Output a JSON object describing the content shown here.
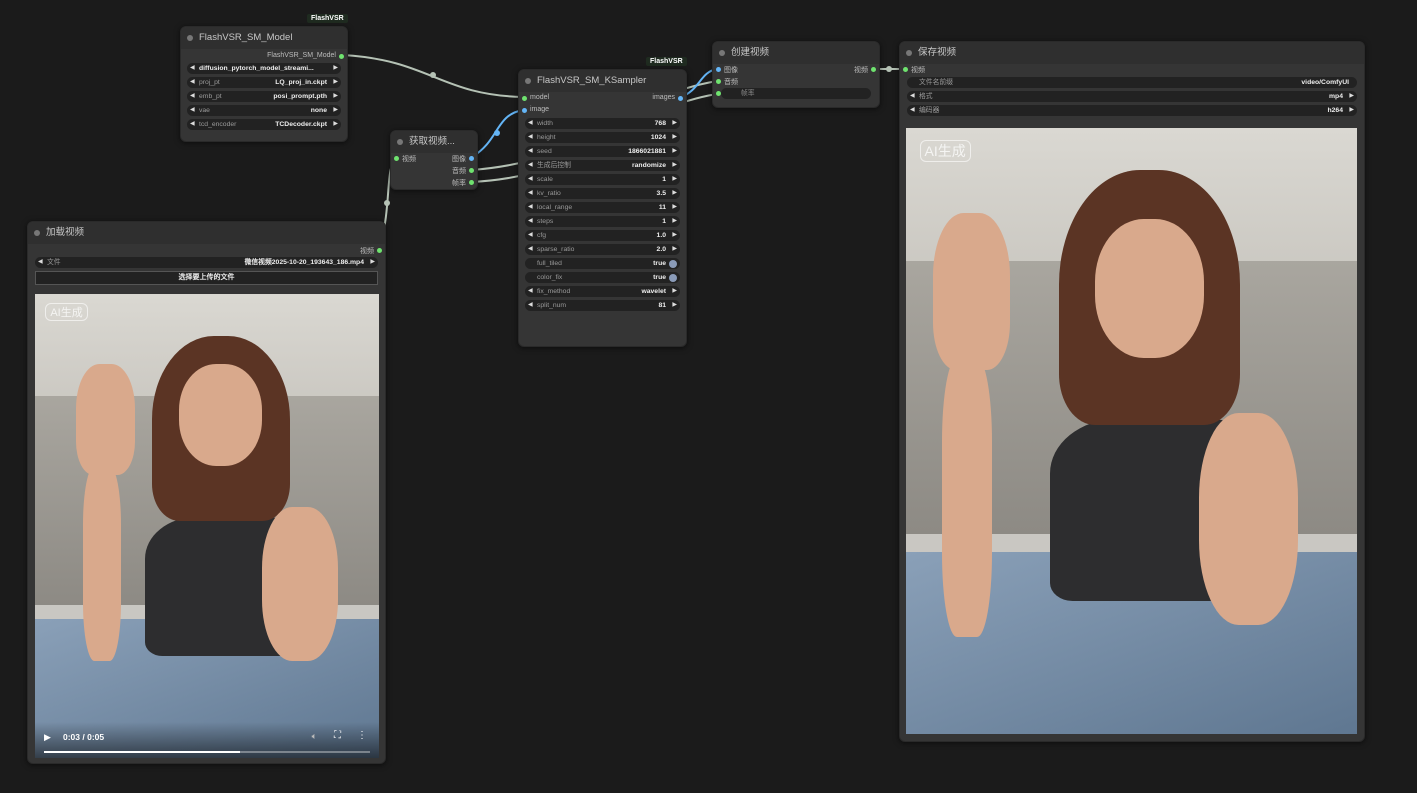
{
  "colors": {
    "canvas": "#1b1b1b",
    "node": "#353535",
    "slot_image": "#64b5f6",
    "slot_other": "#6fe36f"
  },
  "model_node": {
    "title": "FlashVSR_SM_Model",
    "badge": "FlashVSR",
    "output": "FlashVSR_SM_Model",
    "widgets": [
      {
        "label": "",
        "value": "diffusion_pytorch_model_streami..."
      },
      {
        "label": "proj_pt",
        "value": "LQ_proj_in.ckpt"
      },
      {
        "label": "emb_pt",
        "value": "posi_prompt.pth"
      },
      {
        "label": "vae",
        "value": "none"
      },
      {
        "label": "tcd_encoder",
        "value": "TCDecoder.ckpt"
      }
    ]
  },
  "get_video_node": {
    "title": "获取视频...",
    "input": "视频",
    "outputs": [
      "图像",
      "音频",
      "帧率"
    ]
  },
  "sampler_node": {
    "title": "FlashVSR_SM_KSampler",
    "badge": "FlashVSR",
    "inputs": [
      "model",
      "image"
    ],
    "output": "images",
    "widgets": [
      {
        "label": "width",
        "value": "768"
      },
      {
        "label": "height",
        "value": "1024"
      },
      {
        "label": "seed",
        "value": "1866021881"
      },
      {
        "label": "生成后控制",
        "value": "randomize"
      },
      {
        "label": "scale",
        "value": "1"
      },
      {
        "label": "kv_ratio",
        "value": "3.5"
      },
      {
        "label": "local_range",
        "value": "11"
      },
      {
        "label": "steps",
        "value": "1"
      },
      {
        "label": "cfg",
        "value": "1.0"
      },
      {
        "label": "sparse_ratio",
        "value": "2.0"
      },
      {
        "label": "full_tiled",
        "value": "true",
        "toggle": true
      },
      {
        "label": "color_fix",
        "value": "true",
        "toggle": true
      },
      {
        "label": "fix_method",
        "value": "wavelet"
      },
      {
        "label": "split_num",
        "value": "81"
      }
    ]
  },
  "create_video_node": {
    "title": "创建视频",
    "inputs": [
      "图像",
      "音频"
    ],
    "output": "视频",
    "fps_placeholder": "帧率"
  },
  "save_video_node": {
    "title": "保存视频",
    "input": "视频",
    "widgets": [
      {
        "label": "文件名前缀",
        "value": "video/ComfyUI"
      },
      {
        "label": "格式",
        "value": "mp4"
      },
      {
        "label": "编码器",
        "value": "h264"
      }
    ],
    "watermark": "AI生成"
  },
  "load_video_node": {
    "title": "加载视频",
    "output": "视频",
    "file_label": "文件",
    "file_value": "微信视频2025-10-20_193643_186.mp4",
    "upload_label": "选择要上传的文件",
    "watermark": "AI生成",
    "time": "0:03 / 0:05",
    "progress": 0.6
  }
}
